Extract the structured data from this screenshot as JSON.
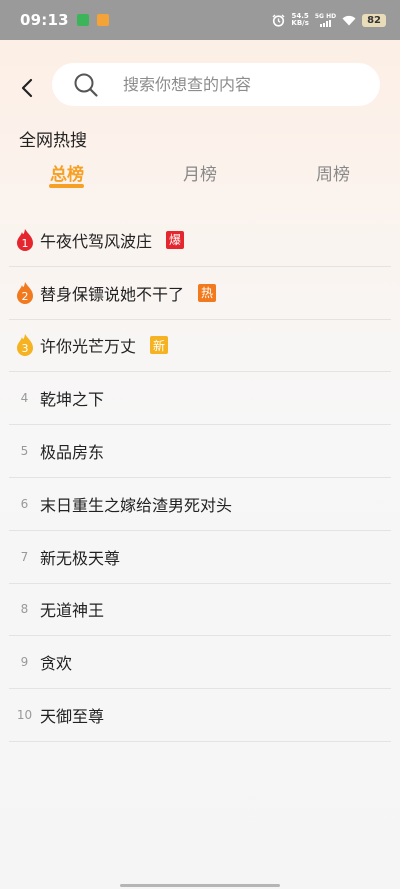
{
  "status_bar": {
    "time": "09:13",
    "speed_value": "54.5",
    "speed_unit": "KB/s",
    "network": "5G HD",
    "battery": "82"
  },
  "search": {
    "placeholder": "搜索你想查的内容"
  },
  "section_title": "全网热搜",
  "tabs": [
    {
      "label": "总榜",
      "active": true
    },
    {
      "label": "月榜",
      "active": false
    },
    {
      "label": "周榜",
      "active": false
    }
  ],
  "colors": {
    "accent": "#f6a025",
    "hot_red": "#e5262e",
    "hot_orange": "#f27a1e",
    "new_yellow": "#f5b322"
  },
  "ranking": [
    {
      "rank": "1",
      "title": "午夜代驾风波庄",
      "badge": "爆",
      "badge_color": "#e5262e",
      "flame_color": "#e5262e"
    },
    {
      "rank": "2",
      "title": "替身保镖说她不干了",
      "badge": "热",
      "badge_color": "#f27a1e",
      "flame_color": "#f27a1e"
    },
    {
      "rank": "3",
      "title": "许你光芒万丈",
      "badge": "新",
      "badge_color": "#f5b322",
      "flame_color": "#f5b322"
    },
    {
      "rank": "4",
      "title": "乾坤之下"
    },
    {
      "rank": "5",
      "title": "极品房东"
    },
    {
      "rank": "6",
      "title": "末日重生之嫁给渣男死对头"
    },
    {
      "rank": "7",
      "title": "新无极天尊"
    },
    {
      "rank": "8",
      "title": "无道神王"
    },
    {
      "rank": "9",
      "title": "贪欢"
    },
    {
      "rank": "10",
      "title": "天御至尊"
    }
  ]
}
